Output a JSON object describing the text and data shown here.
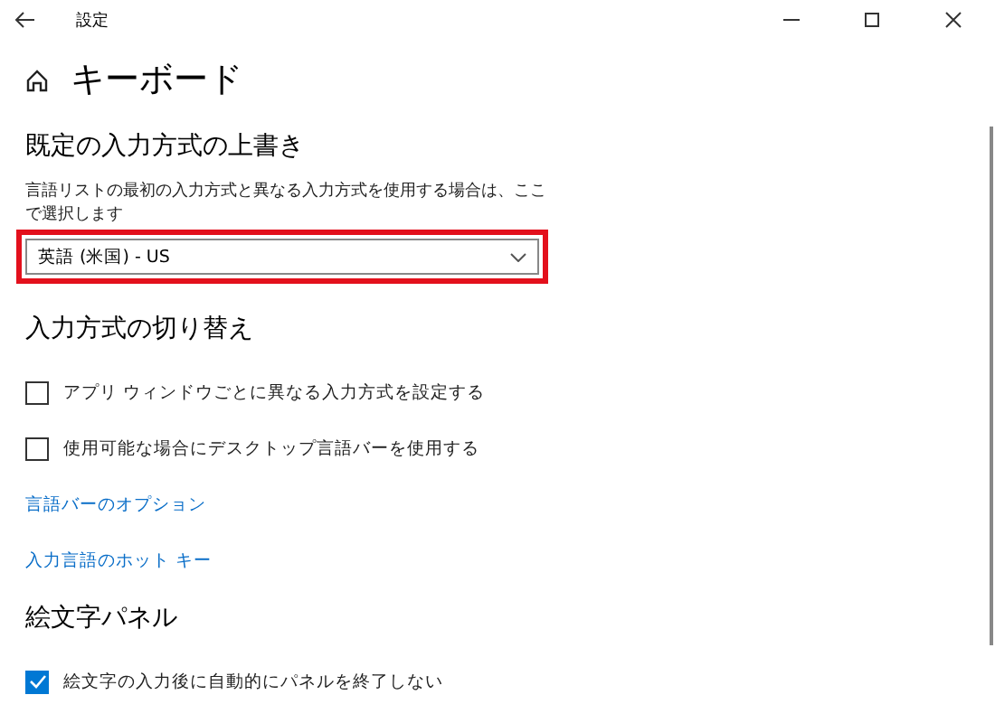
{
  "window": {
    "title": "設定"
  },
  "page": {
    "title": "キーボード"
  },
  "sections": [
    {
      "heading": "既定の入力方式の上書き",
      "items": [
        {
          "kind": "text",
          "text": "言語リストの最初の入力方式と異なる入力方式を使用する場合は、ここで選択します"
        },
        {
          "kind": "dropdown",
          "value": "英語 (米国) - US",
          "highlighted": true
        }
      ]
    },
    {
      "heading": "入力方式の切り替え",
      "items": [
        {
          "kind": "checkbox",
          "label": "アプリ ウィンドウごとに異なる入力方式を設定する",
          "checked": false
        },
        {
          "kind": "checkbox",
          "label": "使用可能な場合にデスクトップ言語バーを使用する",
          "checked": false
        },
        {
          "kind": "link",
          "text": "言語バーのオプション"
        },
        {
          "kind": "link",
          "text": "入力言語のホット キー"
        }
      ]
    },
    {
      "heading": "絵文字パネル",
      "items": [
        {
          "kind": "checkbox",
          "label": "絵文字の入力後に自動的にパネルを終了しない",
          "checked": true
        }
      ]
    }
  ]
}
